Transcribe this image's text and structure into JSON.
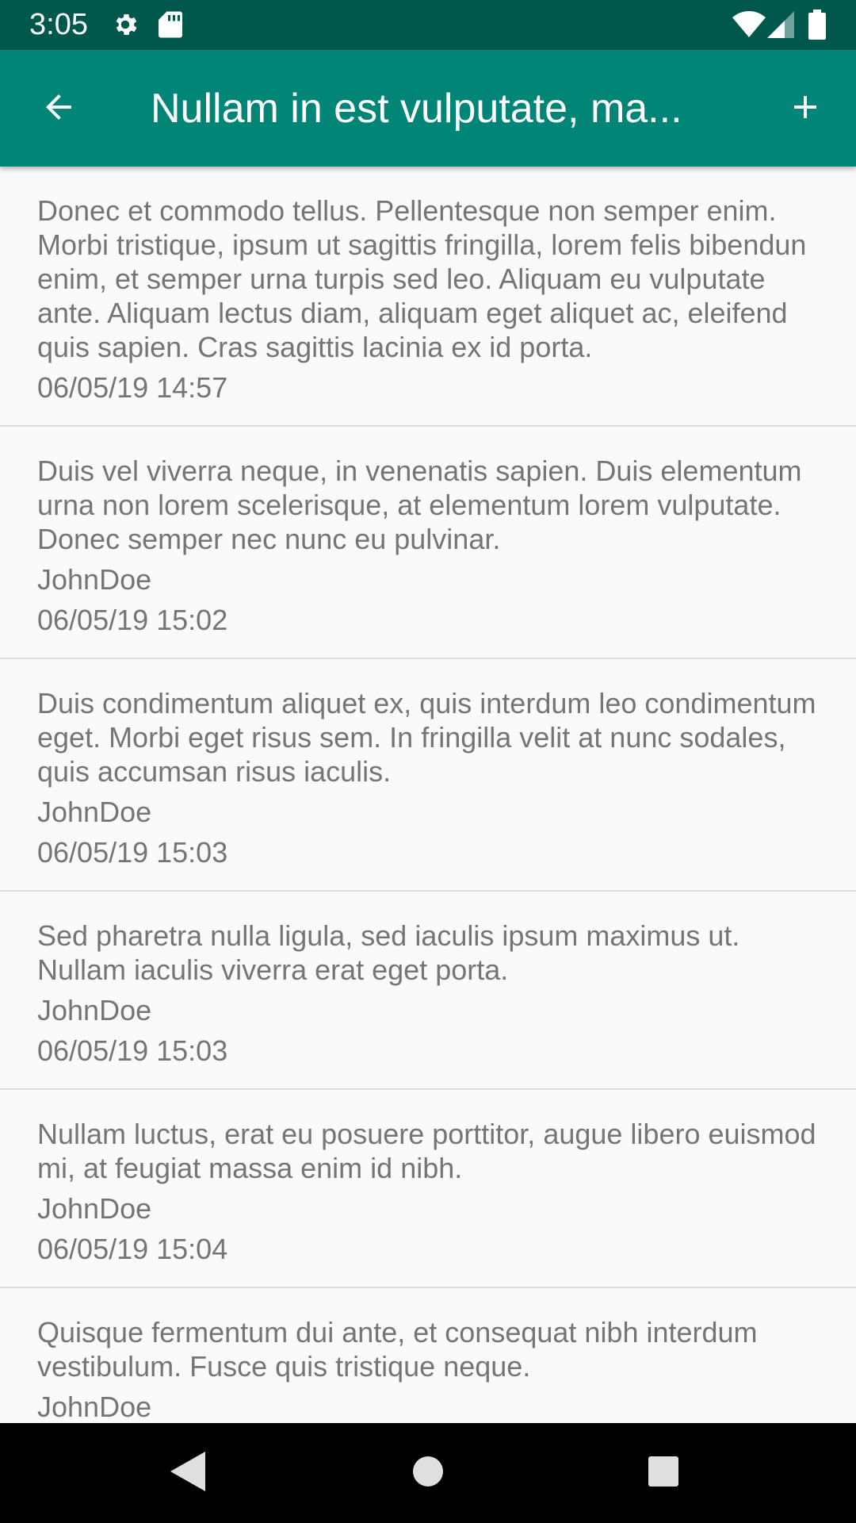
{
  "status_bar": {
    "time": "3:05",
    "icons_left": [
      "gear-icon",
      "sd-card-icon"
    ],
    "icons_right": [
      "wifi-icon",
      "signal-icon",
      "battery-icon"
    ],
    "color": "#00574b"
  },
  "app_bar": {
    "title": "Nullam in est vulputate, ma...",
    "back_icon": "arrow-back-icon",
    "add_icon": "plus-icon",
    "color": "#008577"
  },
  "list": [
    {
      "text": "Donec et commodo tellus. Pellentesque non semper enim.\nMorbi tristique, ipsum ut sagittis fringilla, lorem felis bibendun\nenim, et semper urna turpis sed leo. Aliquam eu vulputate\nante. Aliquam lectus diam, aliquam eget aliquet ac, eleifend\nquis sapien. Cras sagittis lacinia ex id porta.",
      "author": "",
      "date": "06/05/19 14:57"
    },
    {
      "text": "Duis vel viverra neque, in venenatis sapien. Duis elementum\nurna non lorem scelerisque, at elementum lorem vulputate.\nDonec semper nec nunc eu pulvinar.",
      "author": "JohnDoe",
      "date": "06/05/19 15:02"
    },
    {
      "text": "Duis condimentum aliquet ex, quis interdum leo condimentum\neget. Morbi eget risus sem. In fringilla velit at nunc sodales,\nquis accumsan risus iaculis.",
      "author": "JohnDoe",
      "date": "06/05/19 15:03"
    },
    {
      "text": "Sed pharetra nulla ligula, sed iaculis ipsum maximus ut.\nNullam iaculis viverra erat eget porta.",
      "author": "JohnDoe",
      "date": "06/05/19 15:03"
    },
    {
      "text": "Nullam luctus, erat eu posuere porttitor, augue libero euismod\nmi, at feugiat massa enim id nibh.",
      "author": "JohnDoe",
      "date": "06/05/19 15:04"
    },
    {
      "text": "Quisque fermentum dui ante, et consequat nibh interdum\nvestibulum. Fusce quis tristique neque.",
      "author": "JohnDoe",
      "date": ""
    }
  ],
  "nav_bar": {
    "back_icon": "nav-back-icon",
    "home_icon": "nav-home-icon",
    "recents_icon": "nav-recents-icon"
  }
}
